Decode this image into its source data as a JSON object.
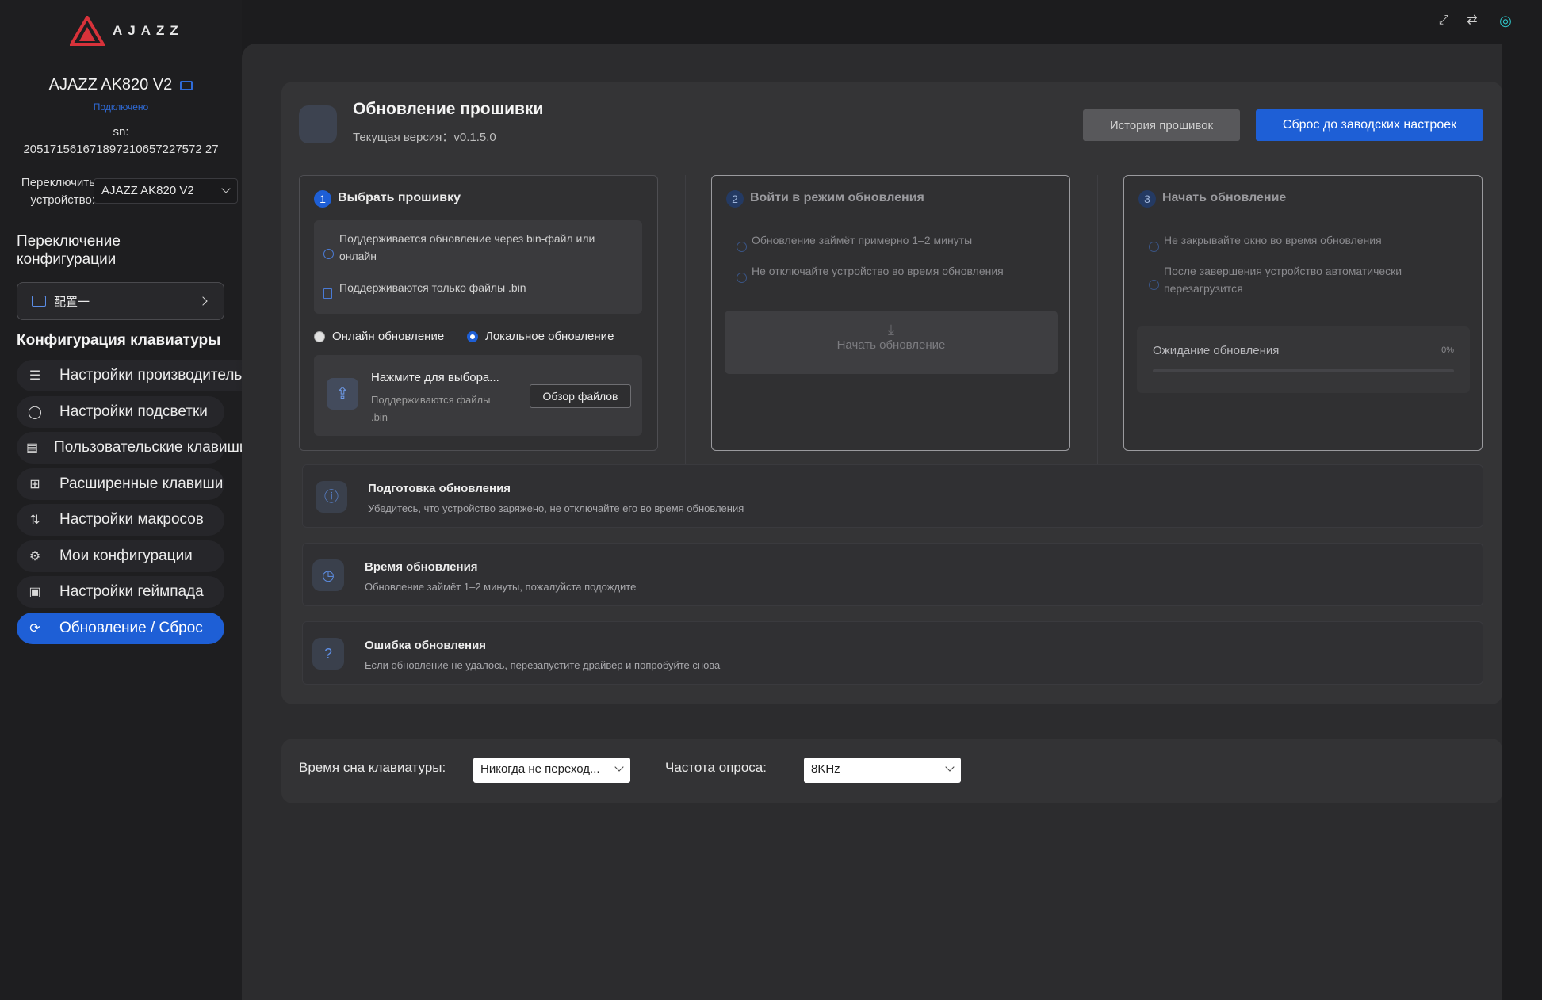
{
  "sidebar": {
    "brand": "AJAZZ",
    "device_name": "AJAZZ AK820 V2",
    "device_status": "Подключено",
    "sn_label": "sn:",
    "sn_value": "205171561671897210657227572 27",
    "switch_label": "Переключить устройство:",
    "switch_value": "AJAZZ AK820 V2",
    "config_switch_title": "Переключение конфигурации",
    "config_value": "配置一",
    "kb_config_title": "Конфигурация клавиатуры",
    "items": [
      {
        "label": "Настройки производительности",
        "icon": "sliders-icon"
      },
      {
        "label": "Настройки подсветки",
        "icon": "bulb-icon"
      },
      {
        "label": "Пользовательские клавиши",
        "icon": "keyboard-icon"
      },
      {
        "label": "Расширенные клавиши",
        "icon": "grid-icon"
      },
      {
        "label": "Настройки макросов",
        "icon": "macro-icon"
      },
      {
        "label": "Мои конфигурации",
        "icon": "gear-icon"
      },
      {
        "label": "Настройки геймпада",
        "icon": "gamepad-icon"
      },
      {
        "label": "Обновление / Сброс",
        "icon": "refresh-icon",
        "active": true
      }
    ]
  },
  "firmware": {
    "title": "Обновление прошивки",
    "version": "Текущая версия：v0.1.5.0",
    "history_button": "История прошивок",
    "reset_button": "Сброс до заводских настроек"
  },
  "steps": [
    {
      "num": "1",
      "title": "Выбрать прошивку",
      "info": [
        "Поддерживается обновление через bin-файл или",
        "онлайн",
        "Поддерживаются только файлы .bin"
      ],
      "radio_online": "Онлайн обновление",
      "radio_local": "Локальное обновление",
      "upload_title": "Нажмите для выбора...",
      "upload_sub": "Поддерживаются файлы .bin",
      "browse_button": "Обзор файлов"
    },
    {
      "num": "2",
      "title": "Войти в режим обновления",
      "info": [
        "Обновление займёт примерно 1–2 минуты",
        "Не отключайте устройство во время обновления"
      ],
      "start_button": "Начать обновление"
    },
    {
      "num": "3",
      "title": "Начать обновление",
      "info": [
        "Не закрывайте окно во время обновления",
        "После завершения устройство автоматически",
        "перезагрузится"
      ],
      "waiting_label": "Ожидание обновления",
      "progress_text": "0%",
      "progress": 0
    }
  ],
  "cards": [
    {
      "title": "Подготовка обновления",
      "desc": "Убедитесь, что устройство заряжено, не отключайте его во время обновления",
      "icon": "info-icon"
    },
    {
      "title": "Время обновления",
      "desc": "Обновление займёт 1–2 минуты, пожалуйста подождите",
      "icon": "clock-icon"
    },
    {
      "title": "Ошибка обновления",
      "desc": "Если обновление не удалось, перезапустите драйвер и попробуйте снова",
      "icon": "help-icon"
    }
  ],
  "bottom": {
    "sleep_label": "Время сна клавиатуры:",
    "sleep_value": "Никогда не переход...",
    "poll_label": "Частота опроса:",
    "poll_value": "8KHz"
  },
  "colors": {
    "accent": "#1e5fd6",
    "brand_logo": "#d8323a"
  }
}
